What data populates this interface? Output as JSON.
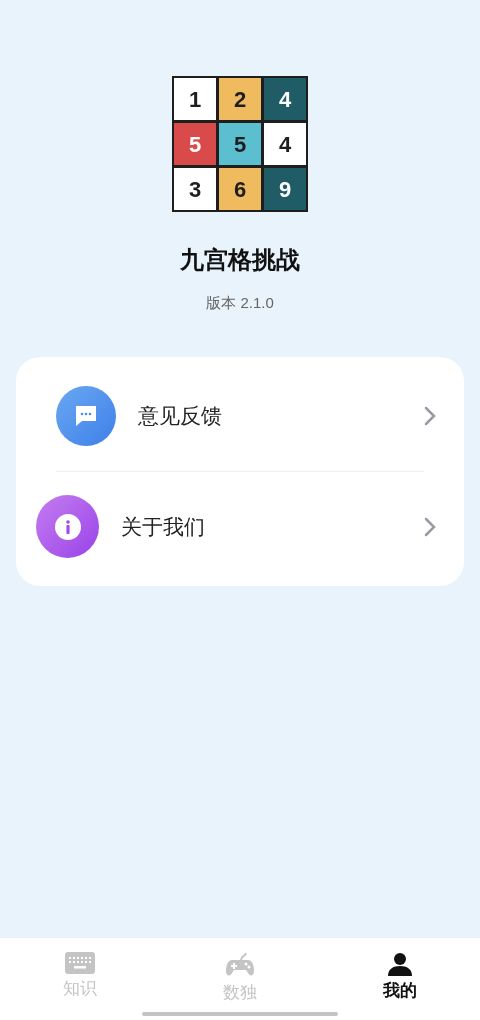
{
  "logo": {
    "cells": [
      {
        "digit": "1",
        "color": "#ffffff"
      },
      {
        "digit": "2",
        "color": "#f0bb5f"
      },
      {
        "digit": "4",
        "color": "#1f5c66"
      },
      {
        "digit": "5",
        "color": "#d94b4b"
      },
      {
        "digit": "5",
        "color": "#5bbfcf"
      },
      {
        "digit": "4",
        "color": "#ffffff"
      },
      {
        "digit": "3",
        "color": "#ffffff"
      },
      {
        "digit": "6",
        "color": "#f0bb5f"
      },
      {
        "digit": "9",
        "color": "#1f5c66"
      }
    ]
  },
  "app_name": "九宫格挑战",
  "version": "版本 2.1.0",
  "menu": [
    {
      "label": "意见反馈",
      "kind": "feedback"
    },
    {
      "label": "关于我们",
      "kind": "about"
    }
  ],
  "tab_bar": [
    {
      "label": "知识",
      "kind": "keyboard",
      "selected": false
    },
    {
      "label": "数独",
      "kind": "gamepad",
      "selected": false
    },
    {
      "label": "我的",
      "kind": "person",
      "selected": true
    }
  ]
}
